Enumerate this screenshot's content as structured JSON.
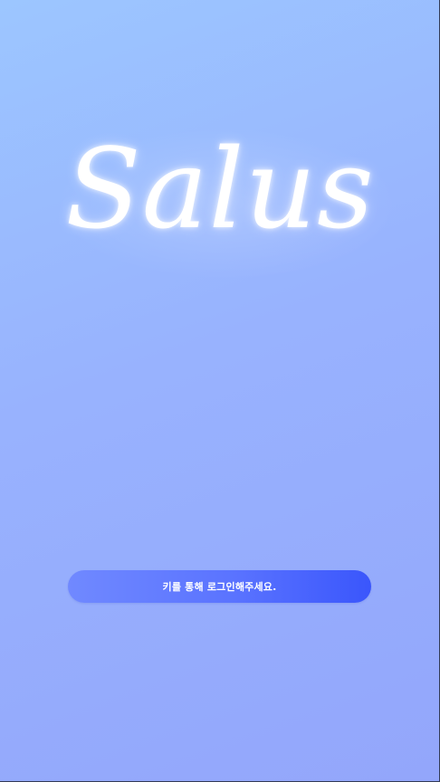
{
  "app": {
    "logo_text": "Salus"
  },
  "login": {
    "button_label": "키를 통해 로그인해주세요."
  },
  "colors": {
    "background_start": "#9cc6ff",
    "background_end": "#93a6fb",
    "button_start": "#7089ff",
    "button_end": "#3a56fc",
    "text": "#ffffff"
  }
}
